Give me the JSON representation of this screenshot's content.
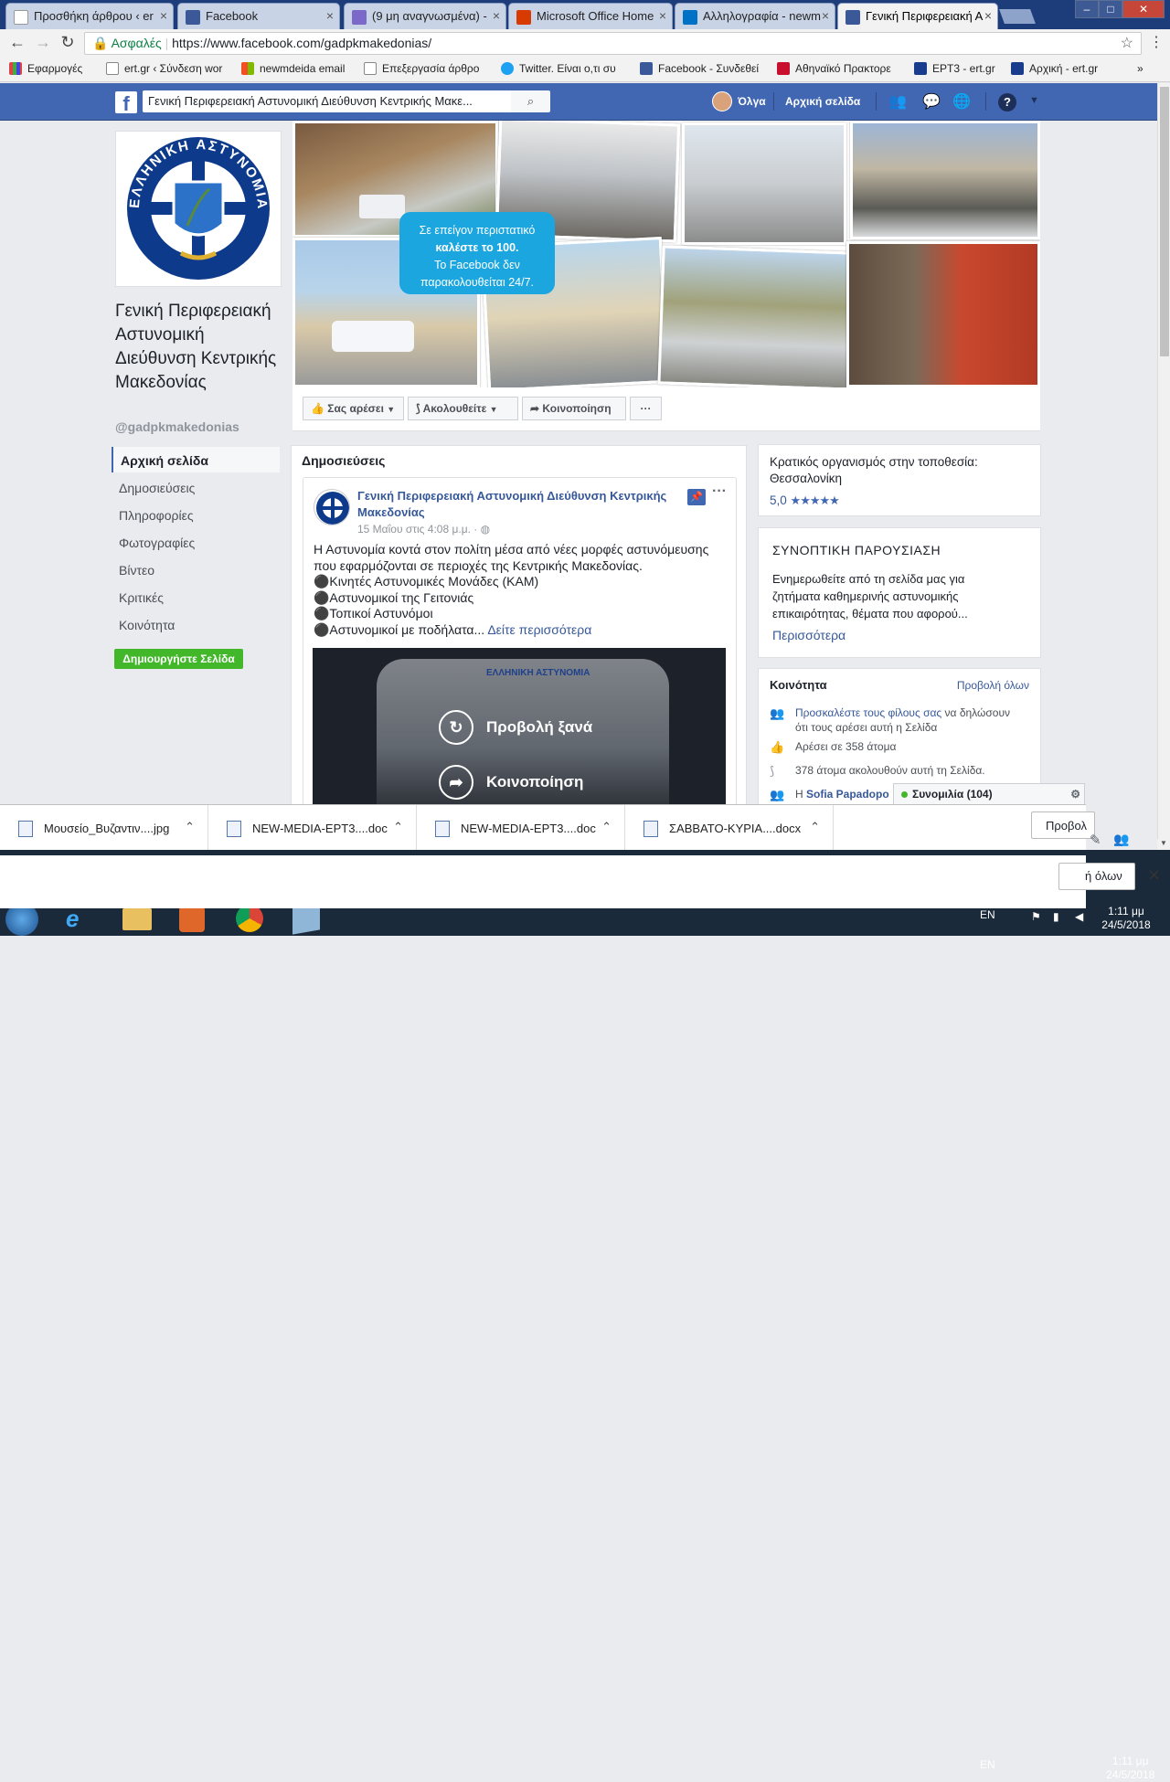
{
  "browser": {
    "tabs": [
      {
        "title": "Προσθήκη άρθρου ‹ er",
        "icon": "wordpress-icon"
      },
      {
        "title": "Facebook",
        "icon": "facebook-icon"
      },
      {
        "title": "(9 μη αναγνωσμένα) -",
        "icon": "mail-icon"
      },
      {
        "title": "Microsoft Office Home",
        "icon": "office-icon"
      },
      {
        "title": "Αλληλογραφία - newm",
        "icon": "outlook-icon"
      },
      {
        "title": "Γενική Περιφερειακή Α",
        "icon": "facebook-icon"
      }
    ],
    "secure_label": "Ασφαλές",
    "url": "https://www.facebook.com/gadpkmakedonias/",
    "bookmarks": [
      "Εφαρμογές",
      "ert.gr ‹ Σύνδεση wor",
      "newmdeida email",
      "Επεξεργασία άρθρο",
      "Twitter. Είναι ο,τι συ",
      "Facebook - Συνδεθεί",
      "Αθηναϊκό Πρακτορε",
      "ΕΡΤ3 - ert.gr",
      "Αρχική - ert.gr"
    ],
    "bookmarks_more": "»"
  },
  "fb": {
    "search_value": "Γενική Περιφερειακή Αστυνομική Διεύθυνση Κεντρικής Μακε...",
    "user": "Όλγα",
    "home": "Αρχική σελίδα"
  },
  "page": {
    "name": "Γενική Περιφερειακή Αστυνομική Διεύθυνση Κεντρικής Μακεδονίας",
    "handle": "@gadpkmakedonias",
    "nav": [
      "Αρχική σελίδα",
      "Δημοσιεύσεις",
      "Πληροφορίες",
      "Φωτογραφίες",
      "Βίντεο",
      "Κριτικές",
      "Κοινότητα"
    ],
    "create_button": "Δημιουργήστε Σελίδα",
    "logo_text": "ΕΛΛΗΝΙΚΗ ΑΣΤΥΝΟΜΙΑ",
    "cover_bubble": [
      "Σε επείγον περιστατικό",
      "καλέστε το 100.",
      "Το Facebook δεν",
      "παρακολουθείται 24/7."
    ],
    "actions": {
      "like": "Σας αρέσει",
      "follow": "Ακολουθείτε",
      "share": "Κοινοποίηση",
      "more": "···"
    }
  },
  "posts": {
    "header": "Δημοσιεύσεις",
    "author": "Γενική Περιφερειακή Αστυνομική Διεύθυνση Κεντρικής Μακεδονίας",
    "date": "15 Μαΐου στις 4:08 μ.μ. ·",
    "text_lines": [
      "Η Αστυνομία κοντά στον πολίτη μέσα από νέες μορφές αστυνόμευσης",
      "που εφαρμόζονται σε περιοχές της Κεντρικής Μακεδονίας.",
      "⚫Κινητές Αστυνομικές Μονάδες (ΚΑΜ)",
      "⚫Αστυνομικοί της Γειτονιάς",
      "⚫Τοπικοί Αστυνόμοι",
      "⚫Αστυνομικοί με ποδήλατα..."
    ],
    "see_more": "Δείτε περισσότερα",
    "replay": "Προβολή ξανά",
    "share": "Κοινοποίηση",
    "van_text": "ΕΛΛΗΝΙΚΗ ΑΣΤΥΝΟΜΙΑ"
  },
  "sidebar": {
    "org_line1": "Κρατικός οργανισμός στην τοποθεσία:",
    "org_line2": "Θεσσαλονίκη",
    "rating": "5,0",
    "rating_stars": 5,
    "about_title": "ΣΥΝΟΠΤΙΚΗ ΠΑΡΟΥΣΙΑΣΗ",
    "about_lines": [
      "Ενημερωθείτε από τη σελίδα μας για",
      "ζητήματα καθημερινής αστυνομικής",
      "επικαιρότητας, θέματα που αφορού..."
    ],
    "about_more": "Περισσότερα",
    "community_title": "Κοινότητα",
    "community_all": "Προβολή όλων",
    "invite_link": "Προσκαλέστε τους φίλους σας",
    "invite_rest": " να δηλώσουν",
    "invite_line2": "ότι τους αρέσει αυτή η Σελίδα",
    "likes": "Αρέσει σε 358 άτομα",
    "follows": "378 άτομα ακολουθούν αυτή τη Σελίδα.",
    "friend_prefix": "Η ",
    "friend_name": "Sofia Papadopo"
  },
  "chat": {
    "label": "Συνομιλία (104)"
  },
  "downloads": {
    "items": [
      "Μουσείο_Βυζαντιν....jpg",
      "NEW-MEDIA-ΕΡΤ3....doc",
      "NEW-MEDIA-ΕΡΤ3....doc",
      "ΣΑΒΒΑΤΟ-ΚΥΡΙΑ....docx"
    ],
    "show_label": "Προβολ",
    "show_all": "ή όλων"
  },
  "taskbar": {
    "lang": "EN",
    "time": "1:11 μμ",
    "date": "24/5/2018"
  }
}
